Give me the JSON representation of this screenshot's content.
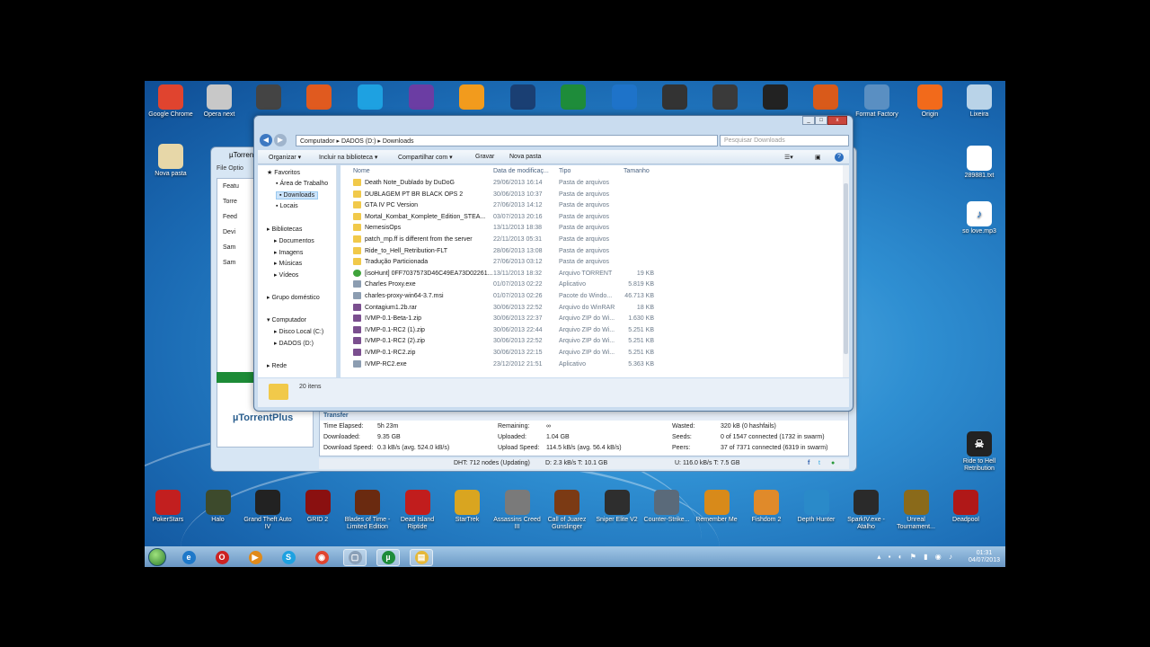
{
  "top_icons": [
    {
      "label": "Google Chrome",
      "icon": "chrome-icon",
      "color": "#e0442f"
    },
    {
      "label": "Opera next",
      "icon": "opera-icon",
      "color": "#c8c8c8"
    },
    {
      "label": "",
      "icon": "camera-icon",
      "color": "#444444"
    },
    {
      "label": "",
      "icon": "app-icon",
      "color": "#e05a1f"
    },
    {
      "label": "",
      "icon": "skype-icon",
      "color": "#1ea1e1"
    },
    {
      "label": "",
      "icon": "app-icon",
      "color": "#6b3da3"
    },
    {
      "label": "",
      "icon": "app-icon",
      "color": "#f29b1d"
    },
    {
      "label": "",
      "icon": "photoshop-icon",
      "color": "#1a3f73"
    },
    {
      "label": "",
      "icon": "utorrent-icon",
      "color": "#1e8c3a"
    },
    {
      "label": "",
      "icon": "lightning-icon",
      "color": "#1e73c9"
    },
    {
      "label": "",
      "icon": "app-icon",
      "color": "#333333"
    },
    {
      "label": "",
      "icon": "video-icon",
      "color": "#3a3a3a"
    },
    {
      "label": "",
      "icon": "app-icon",
      "color": "#222222"
    },
    {
      "label": "",
      "icon": "media-icon",
      "color": "#d95a1a"
    },
    {
      "label": "Format Factory",
      "icon": "format-factory-icon",
      "color": "#5a8fc2"
    },
    {
      "label": "Origin",
      "icon": "origin-icon",
      "color": "#f26a1b"
    },
    {
      "label": "Lixeira",
      "icon": "recycle-bin-icon",
      "color": "#b9d3e8"
    }
  ],
  "left_icon": {
    "label": "Nova pasta"
  },
  "right_icons": [
    {
      "label": "289881.txt"
    },
    {
      "label": "so love.mp3"
    },
    {
      "label": "Ride to Hell Retribution"
    }
  ],
  "bottom_icons": [
    {
      "label": "PokerStars",
      "color": "#c21f1f"
    },
    {
      "label": "Halo",
      "color": "#3d4a2c"
    },
    {
      "label": "Grand Theft Auto IV",
      "color": "#222222"
    },
    {
      "label": "GRID 2",
      "color": "#8a1010"
    },
    {
      "label": "Blades of Time - Limited Edition",
      "color": "#6a2a10"
    },
    {
      "label": "Dead Island Riptide",
      "color": "#c11d1d"
    },
    {
      "label": "StarTrek",
      "color": "#d9a520"
    },
    {
      "label": "Assassins Creed III",
      "color": "#7a7a7a"
    },
    {
      "label": "Call of Juarez Gunslinger",
      "color": "#7b3a14"
    },
    {
      "label": "Sniper Elite V2",
      "color": "#2e2e2e"
    },
    {
      "label": "Counter-Strike...",
      "color": "#5a6a7a"
    },
    {
      "label": "Remember Me",
      "color": "#d88a1a"
    },
    {
      "label": "Fishdom 2",
      "color": "#e08a2a"
    },
    {
      "label": "Depth Hunter",
      "color": "#2a8ac9"
    },
    {
      "label": "SparkIV.exe - Atalho",
      "color": "#2a2a2a"
    },
    {
      "label": "Unreal Tournament...",
      "color": "#8a6a1a"
    },
    {
      "label": "Deadpool",
      "color": "#b01818"
    }
  ],
  "utorrent": {
    "title": "µTorrent",
    "menu": "File  Optio",
    "side": [
      "Featu",
      "Torre",
      "Feed",
      "Devi",
      "Sam",
      "Sam"
    ],
    "plus_logo": "µTorrentPlus",
    "transfer_title": "Transfer",
    "rows": [
      {
        "k1": "Time Elapsed:",
        "v1": "5h 23m",
        "k2": "Remaining:",
        "v2": "∞",
        "k3": "Wasted:",
        "v3": "320 kB (0 hashfails)"
      },
      {
        "k1": "Downloaded:",
        "v1": "9.35 GB",
        "k2": "Uploaded:",
        "v2": "1.04 GB",
        "k3": "Seeds:",
        "v3": "0 of 1547 connected (1732 in swarm)"
      },
      {
        "k1": "Download Speed:",
        "v1": "0.3 kB/s (avg. 524.0 kB/s)",
        "k2": "Upload Speed:",
        "v2": "114.5 kB/s (avg. 56.4 kB/s)",
        "k3": "Peers:",
        "v3": "37 of 7371 connected (6319 in swarm)"
      }
    ],
    "status": {
      "dht": "DHT: 712 nodes (Updating)",
      "down": "D: 2.3 kB/s T: 10.1 GB",
      "up": "U: 116.0 kB/s T: 7.5 GB"
    }
  },
  "explorer": {
    "address": [
      "Computador",
      "DADOS (D:)",
      "Downloads"
    ],
    "search_placeholder": "Pesquisar Downloads",
    "toolbar": [
      "Organizar ▾",
      "Incluir na biblioteca ▾",
      "Compartilhar com ▾",
      "Gravar",
      "Nova pasta"
    ],
    "tree": {
      "favoritos": "Favoritos",
      "area_trabalho": "Área de Trabalho",
      "downloads": "Downloads",
      "locais": "Locais",
      "bibliotecas": "Bibliotecas",
      "documentos": "Documentos",
      "imagens": "Imagens",
      "musicas": "Músicas",
      "videos": "Vídeos",
      "grupo": "Grupo doméstico",
      "computador": "Computador",
      "disco_local": "Disco Local (C:)",
      "dados": "DADOS (D:)",
      "rede": "Rede"
    },
    "columns": {
      "name": "Nome",
      "date": "Data de modificaç...",
      "type": "Tipo",
      "size": "Tamanho"
    },
    "files": [
      {
        "name": "Death Note_Dublado by DuDoG",
        "date": "29/06/2013 16:14",
        "type": "Pasta de arquivos",
        "size": "",
        "kind": "folder"
      },
      {
        "name": "DUBLAGEM PT BR BLACK OPS 2",
        "date": "30/06/2013 10:37",
        "type": "Pasta de arquivos",
        "size": "",
        "kind": "folder"
      },
      {
        "name": "GTA IV PC Version",
        "date": "27/06/2013 14:12",
        "type": "Pasta de arquivos",
        "size": "",
        "kind": "folder"
      },
      {
        "name": "Mortal_Kombat_Komplete_Edition_STEA...",
        "date": "03/07/2013 20:16",
        "type": "Pasta de arquivos",
        "size": "",
        "kind": "folder"
      },
      {
        "name": "NemesisOps",
        "date": "13/11/2013 18:38",
        "type": "Pasta de arquivos",
        "size": "",
        "kind": "folder"
      },
      {
        "name": "patch_mp.ff is different from the server",
        "date": "22/11/2013 05:31",
        "type": "Pasta de arquivos",
        "size": "",
        "kind": "folder"
      },
      {
        "name": "Ride_to_Hell_Retribution-FLT",
        "date": "28/06/2013 13:08",
        "type": "Pasta de arquivos",
        "size": "",
        "kind": "folder"
      },
      {
        "name": "Tradução Particionada",
        "date": "27/06/2013 03:12",
        "type": "Pasta de arquivos",
        "size": "",
        "kind": "folder"
      },
      {
        "name": "[isoHunt] 0FF7037573D46C49EA73D02261...",
        "date": "13/11/2013 18:32",
        "type": "Arquivo TORRENT",
        "size": "19 KB",
        "kind": "torrent"
      },
      {
        "name": "Charles Proxy.exe",
        "date": "01/07/2013 02:22",
        "type": "Aplicativo",
        "size": "5.819 KB",
        "kind": "file"
      },
      {
        "name": "charles-proxy-win64-3.7.msi",
        "date": "01/07/2013 02:26",
        "type": "Pacote do Windo...",
        "size": "46.713 KB",
        "kind": "file"
      },
      {
        "name": "Contagium1.2b.rar",
        "date": "30/06/2013 22:52",
        "type": "Arquivo do WinRAR",
        "size": "18 KB",
        "kind": "zip"
      },
      {
        "name": "IVMP-0.1-Beta-1.zip",
        "date": "30/06/2013 22:37",
        "type": "Arquivo ZIP do Wi...",
        "size": "1.630 KB",
        "kind": "zip"
      },
      {
        "name": "IVMP-0.1-RC2 (1).zip",
        "date": "30/06/2013 22:44",
        "type": "Arquivo ZIP do Wi...",
        "size": "5.251 KB",
        "kind": "zip"
      },
      {
        "name": "IVMP-0.1-RC2 (2).zip",
        "date": "30/06/2013 22:52",
        "type": "Arquivo ZIP do Wi...",
        "size": "5.251 KB",
        "kind": "zip"
      },
      {
        "name": "IVMP-0.1-RC2.zip",
        "date": "30/06/2013 22:15",
        "type": "Arquivo ZIP do Wi...",
        "size": "5.251 KB",
        "kind": "zip"
      },
      {
        "name": "IVMP-RC2.exe",
        "date": "23/12/2012 21:51",
        "type": "Aplicativo",
        "size": "5.363 KB",
        "kind": "file"
      }
    ],
    "item_count": "20 itens"
  },
  "taskbar": {
    "time": "01:31",
    "date": "04/07/2013",
    "pinned": [
      {
        "icon": "ie-icon",
        "color": "#1e78c9",
        "glyph": "e"
      },
      {
        "icon": "opera-icon",
        "color": "#cc2222",
        "glyph": "O"
      },
      {
        "icon": "media-player-icon",
        "color": "#e08a1a",
        "glyph": "▶"
      },
      {
        "icon": "skype-icon",
        "color": "#1ea1e1",
        "glyph": "S"
      },
      {
        "icon": "chrome-icon",
        "color": "#e0442f",
        "glyph": "◉"
      },
      {
        "icon": "app-icon",
        "color": "#8aa0b8",
        "glyph": "▢"
      },
      {
        "icon": "utorrent-icon",
        "color": "#1e8c3a",
        "glyph": "µ"
      },
      {
        "icon": "folder-icon",
        "color": "#e5b83a",
        "glyph": "▤"
      }
    ]
  }
}
